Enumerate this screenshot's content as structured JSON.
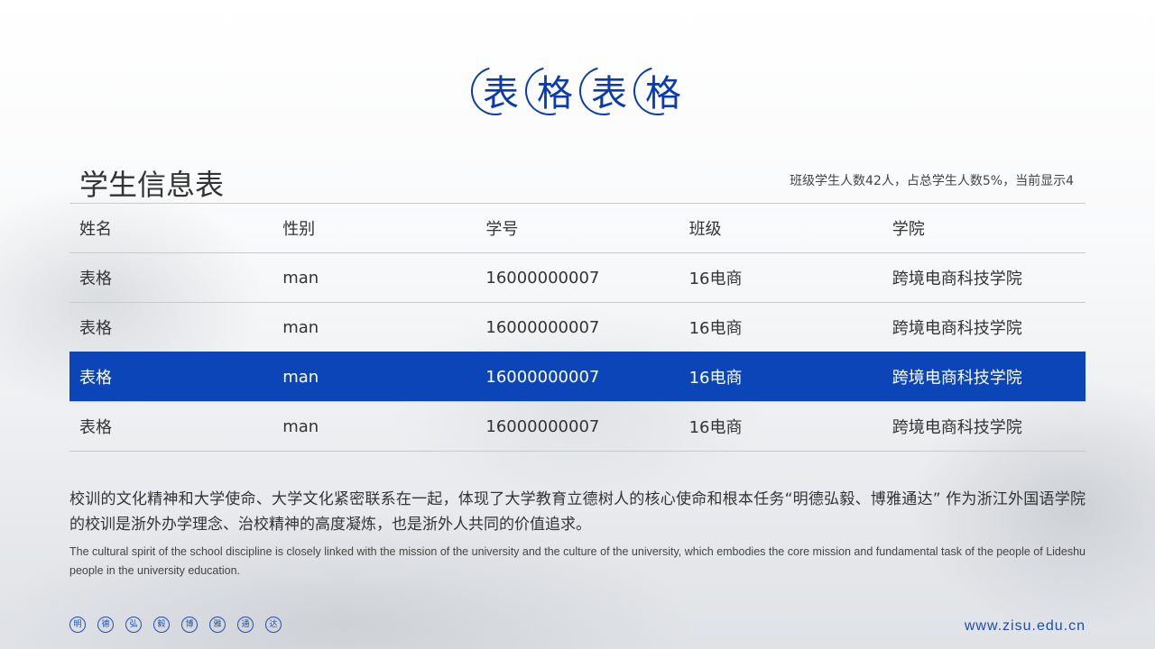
{
  "slide_title_chars": [
    "表",
    "格",
    "表",
    "格"
  ],
  "panel": {
    "title": "学生信息表",
    "note": "班级学生人数42人，占总学生人数5%，当前显示4"
  },
  "table": {
    "columns": [
      "姓名",
      "性别",
      "学号",
      "班级",
      "学院"
    ],
    "rows": [
      [
        "表格",
        "man",
        "16000000007",
        "16电商",
        "跨境电商科技学院"
      ],
      [
        "表格",
        "man",
        "16000000007",
        "16电商",
        "跨境电商科技学院"
      ],
      [
        "表格",
        "man",
        "16000000007",
        "16电商",
        "跨境电商科技学院"
      ],
      [
        "表格",
        "man",
        "16000000007",
        "16电商",
        "跨境电商科技学院"
      ]
    ],
    "selected_row": 3
  },
  "paragraph_cn": "校训的文化精神和大学使命、大学文化紧密联系在一起，体现了大学教育立德树人的核心使命和根本任务“明德弘毅、博雅通达” 作为浙江外国语学院的校训是浙外办学理念、治校精神的高度凝炼，也是浙外人共同的价值追求。",
  "paragraph_en": "The cultural spirit of the school discipline is closely linked with the mission of the university and the culture of the university, which embodies the core mission and fundamental task of the people of Lideshu people in the university education.",
  "motto_chars": [
    "明",
    "德",
    "弘",
    "毅",
    "博",
    "雅",
    "通",
    "达"
  ],
  "website": "www.zisu.edu.cn",
  "colors": {
    "accent": "#0b45b8",
    "text": "#333333"
  }
}
